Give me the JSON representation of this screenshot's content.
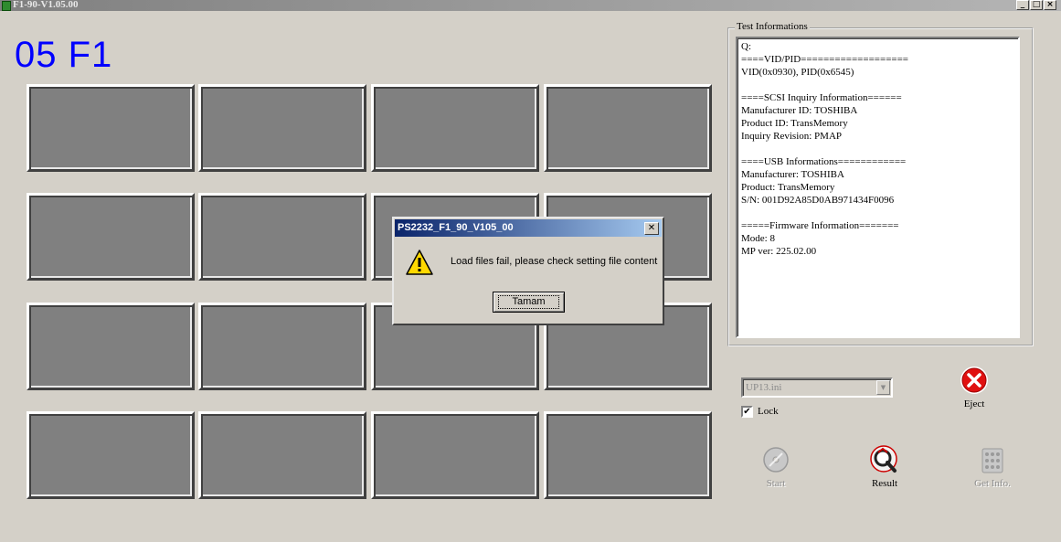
{
  "window": {
    "title": "F1-90-V1.05.00",
    "minimize_icon": "_",
    "maximize_icon": "□",
    "close_icon": "×"
  },
  "main": {
    "device_label": "05 F1",
    "slot_count": 16
  },
  "test_info": {
    "group_title": "Test Informations",
    "lines": [
      "Q:",
      "====VID/PID===================",
      "VID(0x0930), PID(0x6545)",
      "",
      "====SCSI Inquiry Information======",
      "Manufacturer ID: TOSHIBA",
      "Product ID: TransMemory",
      "Inquiry Revision: PMAP",
      "",
      "====USB Informations============",
      "Manufacturer: TOSHIBA",
      "Product: TransMemory",
      "S/N: 001D92A85D0AB971434F0096",
      "",
      "=====Firmware Information=======",
      "Mode: 8",
      "MP ver: 225.02.00"
    ]
  },
  "controls": {
    "config_select": {
      "value": "UP13.ini",
      "enabled": false
    },
    "lock": {
      "label": "Lock",
      "checked": true,
      "check_mark": "✔"
    },
    "eject_label": "Eject",
    "start_label": "Start",
    "result_label": "Result",
    "get_info_label": "Get Info."
  },
  "dialog": {
    "title": "PS2232_F1_90_V105_00",
    "message": "Load files fail, please check setting file content",
    "ok_label": "Tamam",
    "close_icon": "✕",
    "icon": "warning-icon"
  },
  "colors": {
    "background": "#d4d0c8",
    "slot": "#808080",
    "device_label": "#0000ff",
    "dialog_title_start": "#0a246a",
    "dialog_title_end": "#a6caf0"
  }
}
